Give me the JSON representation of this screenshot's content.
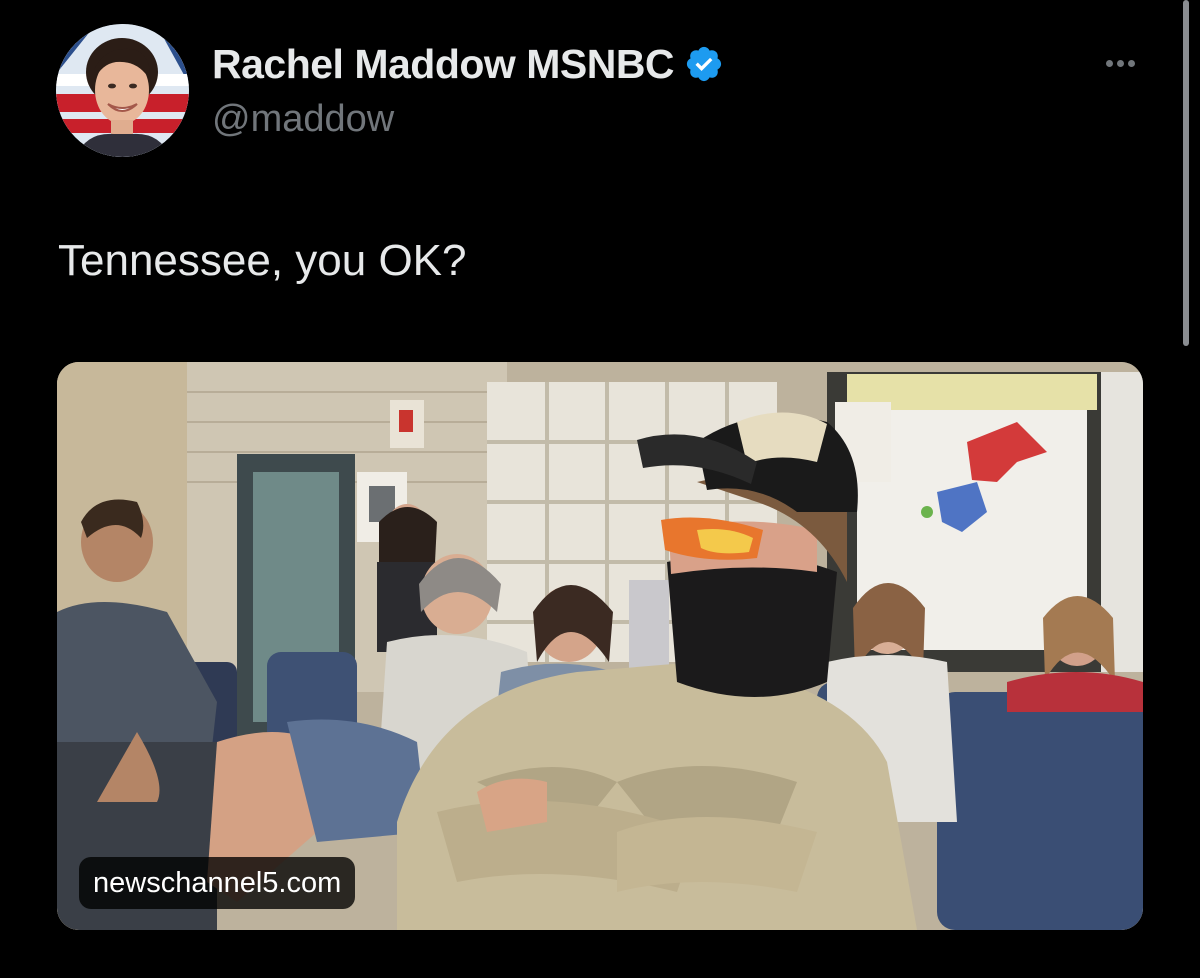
{
  "tweet": {
    "author": {
      "display_name": "Rachel Maddow MSNBC",
      "handle": "@maddow",
      "verified": true,
      "avatar_icon": "profile-photo"
    },
    "more_icon": "ellipsis-icon",
    "text": "Tennessee, you OK?",
    "media": {
      "type": "photo",
      "source_label": "newschannel5.com"
    }
  },
  "colors": {
    "background": "#000000",
    "primary_text": "#e7e9ea",
    "secondary_text": "#71767b",
    "verified_badge": "#1d9bf0"
  }
}
